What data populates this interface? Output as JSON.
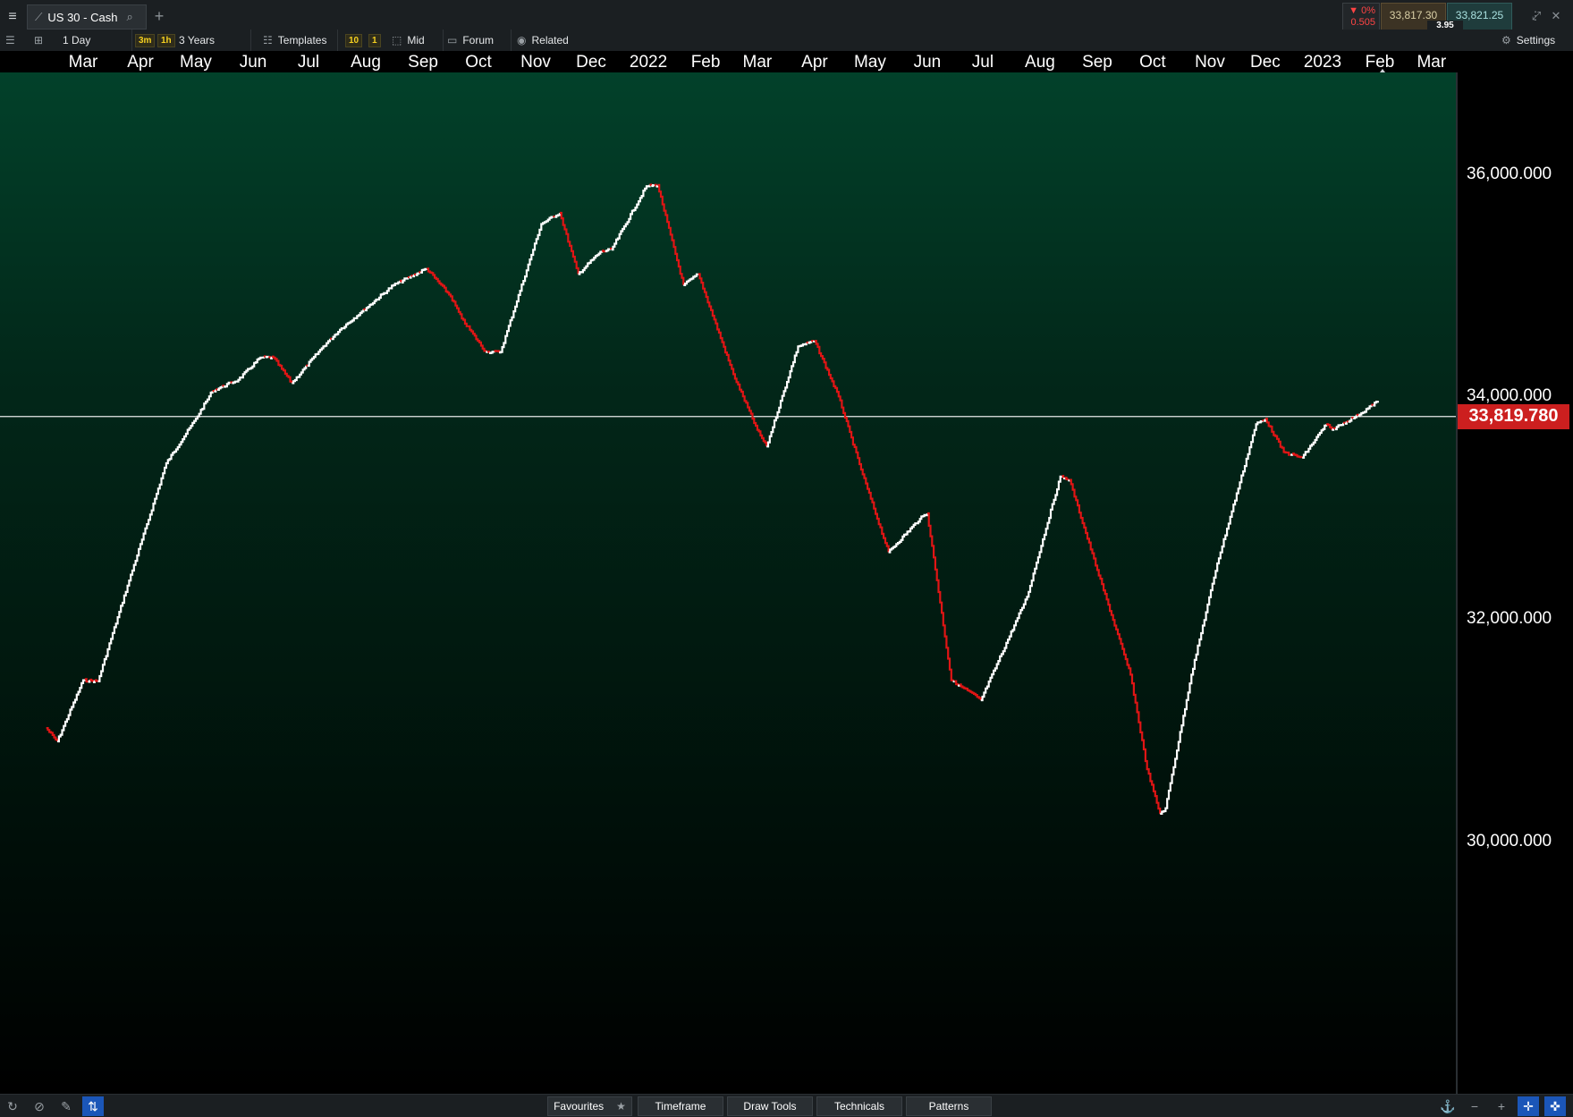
{
  "window": {
    "tab_title": "US 30 - Cash",
    "change_pct": "▼ 0%",
    "change_abs": "0.505",
    "bid": "33,817.30",
    "ask": "33,821.25",
    "spread": "3.95"
  },
  "toolbar": {
    "interval": "1 Day",
    "fav_3m": "3m",
    "fav_1h": "1h",
    "range": "3 Years",
    "templates": "Templates",
    "badge_10": "10",
    "badge_1": "1",
    "mid": "Mid",
    "forum": "Forum",
    "related": "Related",
    "settings": "Settings"
  },
  "time_axis": [
    {
      "label": "Mar",
      "date": "2021-03-01"
    },
    {
      "label": "Apr",
      "date": "2021-04-01"
    },
    {
      "label": "May",
      "date": "2021-05-01"
    },
    {
      "label": "Jun",
      "date": "2021-06-01"
    },
    {
      "label": "Jul",
      "date": "2021-07-01"
    },
    {
      "label": "Aug",
      "date": "2021-08-01"
    },
    {
      "label": "Sep",
      "date": "2021-09-01"
    },
    {
      "label": "Oct",
      "date": "2021-10-01"
    },
    {
      "label": "Nov",
      "date": "2021-11-01"
    },
    {
      "label": "Dec",
      "date": "2021-12-01"
    },
    {
      "label": "2022",
      "date": "2022-01-01"
    },
    {
      "label": "Feb",
      "date": "2022-02-01"
    },
    {
      "label": "Mar",
      "date": "2022-03-01"
    },
    {
      "label": "Apr",
      "date": "2022-04-01"
    },
    {
      "label": "May",
      "date": "2022-05-01"
    },
    {
      "label": "Jun",
      "date": "2022-06-01"
    },
    {
      "label": "Jul",
      "date": "2022-07-01"
    },
    {
      "label": "Aug",
      "date": "2022-08-01"
    },
    {
      "label": "Sep",
      "date": "2022-09-01"
    },
    {
      "label": "Oct",
      "date": "2022-10-01"
    },
    {
      "label": "Nov",
      "date": "2022-11-01"
    },
    {
      "label": "Dec",
      "date": "2022-12-01"
    },
    {
      "label": "2023",
      "date": "2023-01-01"
    },
    {
      "label": "Feb",
      "date": "2023-02-01"
    },
    {
      "label": "Mar",
      "date": "2023-03-01"
    }
  ],
  "price_axis": [
    "36,000.000",
    "34,000.000",
    "32,000.000",
    "30,000.000"
  ],
  "current_price_label": "33,819.780",
  "chart_data": {
    "type": "line",
    "x_axis": "date",
    "y_range": [
      28600,
      37000
    ],
    "current_price": 33819.78,
    "line_colors": {
      "up": "#ffffff",
      "down": "#e01515"
    },
    "points": [
      [
        "2021-02-09",
        31020
      ],
      [
        "2021-02-15",
        30900
      ],
      [
        "2021-03-01",
        31450
      ],
      [
        "2021-03-09",
        31440
      ],
      [
        "2021-03-25",
        32300
      ],
      [
        "2021-04-15",
        33400
      ],
      [
        "2021-05-01",
        33800
      ],
      [
        "2021-05-10",
        34050
      ],
      [
        "2021-05-24",
        34150
      ],
      [
        "2021-06-05",
        34350
      ],
      [
        "2021-06-12",
        34350
      ],
      [
        "2021-06-22",
        34120
      ],
      [
        "2021-07-09",
        34450
      ],
      [
        "2021-07-18",
        34600
      ],
      [
        "2021-07-29",
        34750
      ],
      [
        "2021-08-16",
        35000
      ],
      [
        "2021-09-03",
        35150
      ],
      [
        "2021-09-16",
        34900
      ],
      [
        "2021-09-22",
        34700
      ],
      [
        "2021-10-05",
        34400
      ],
      [
        "2021-10-13",
        34400
      ],
      [
        "2021-11-04",
        35550
      ],
      [
        "2021-11-14",
        35650
      ],
      [
        "2021-11-24",
        35100
      ],
      [
        "2021-12-06",
        35300
      ],
      [
        "2021-12-12",
        35320
      ],
      [
        "2021-12-31",
        35890
      ],
      [
        "2022-01-06",
        35900
      ],
      [
        "2022-01-20",
        35000
      ],
      [
        "2022-01-28",
        35100
      ],
      [
        "2022-02-16",
        34200
      ],
      [
        "2022-03-01",
        33700
      ],
      [
        "2022-03-06",
        33550
      ],
      [
        "2022-03-23",
        34450
      ],
      [
        "2022-04-01",
        34500
      ],
      [
        "2022-04-14",
        34000
      ],
      [
        "2022-04-27",
        33300
      ],
      [
        "2022-05-11",
        32600
      ],
      [
        "2022-05-28",
        32900
      ],
      [
        "2022-06-01",
        32950
      ],
      [
        "2022-06-14",
        31450
      ],
      [
        "2022-06-28",
        31300
      ],
      [
        "2022-06-30",
        31270
      ],
      [
        "2022-07-25",
        32200
      ],
      [
        "2022-08-12",
        33280
      ],
      [
        "2022-08-17",
        33250
      ],
      [
        "2022-09-01",
        32440
      ],
      [
        "2022-09-19",
        31500
      ],
      [
        "2022-09-28",
        30650
      ],
      [
        "2022-10-05",
        30250
      ],
      [
        "2022-10-08",
        30300
      ],
      [
        "2022-10-22",
        31500
      ],
      [
        "2022-11-05",
        32500
      ],
      [
        "2022-11-26",
        33750
      ],
      [
        "2022-12-01",
        33800
      ],
      [
        "2022-12-11",
        33500
      ],
      [
        "2022-12-21",
        33450
      ],
      [
        "2023-01-03",
        33750
      ],
      [
        "2023-01-06",
        33700
      ],
      [
        "2023-01-22",
        33850
      ],
      [
        "2023-01-31",
        33960
      ]
    ]
  },
  "bottom_tabs": [
    "Favourites",
    "Timeframe",
    "Draw Tools",
    "Technicals",
    "Patterns"
  ]
}
